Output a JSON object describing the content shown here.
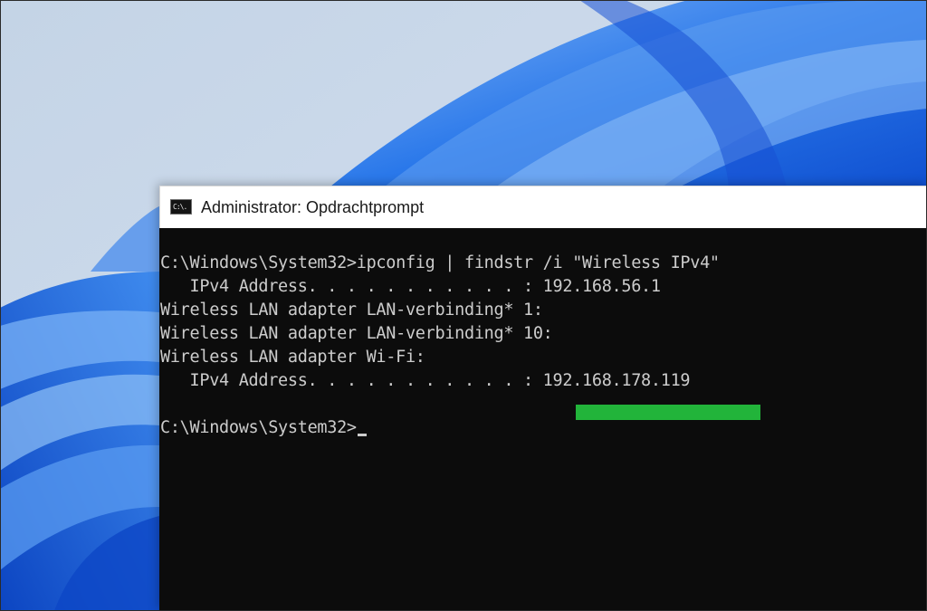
{
  "window": {
    "title": "Administrator: Opdrachtprompt",
    "icon_label": "C:\\."
  },
  "console": {
    "lines": [
      "C:\\Windows\\System32>ipconfig | findstr /i \"Wireless IPv4\"",
      "   IPv4 Address. . . . . . . . . . . : 192.168.56.1",
      "Wireless LAN adapter LAN-verbinding* 1:",
      "Wireless LAN adapter LAN-verbinding* 10:",
      "Wireless LAN adapter Wi-Fi:",
      "   IPv4 Address. . . . . . . . . . . : 192.168.178.119",
      "",
      "C:\\Windows\\System32>"
    ]
  },
  "colors": {
    "console_background": "#0c0c0c",
    "console_text": "#cccccc",
    "highlight": "#22b43a",
    "titlebar": "#ffffff",
    "wallpaper_light": "#c9d9ec",
    "wallpaper_blue": "#1f6fe5"
  },
  "icons": {
    "window_icon": "command-prompt-icon",
    "cursor": "text-cursor-icon"
  }
}
